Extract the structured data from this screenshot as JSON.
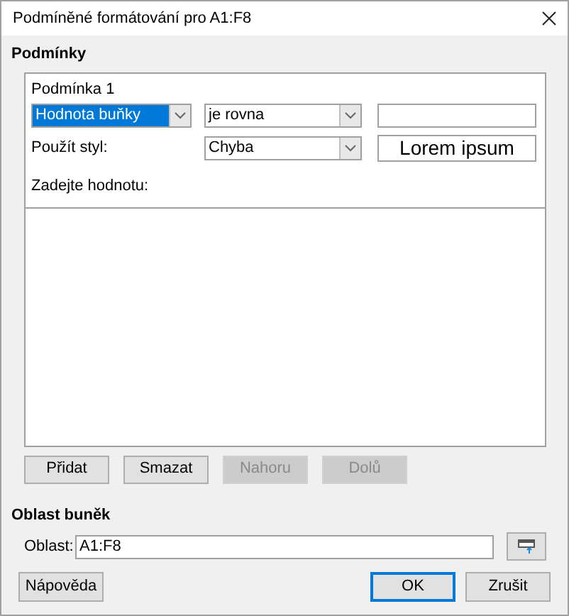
{
  "window": {
    "title": "Podmíněné formátování pro A1:F8"
  },
  "conditions": {
    "heading": "Podmínky",
    "items": [
      {
        "title": "Podmínka 1",
        "condition_type": {
          "value": "Hodnota buňky",
          "highlighted": true
        },
        "operator": {
          "value": "je rovna",
          "highlighted": false
        },
        "style_label": "Použít styl:",
        "style": {
          "value": "Chyba",
          "highlighted": false
        },
        "preview": "Lorem ipsum",
        "hint": "Zadejte hodnotu:"
      }
    ]
  },
  "list_buttons": [
    {
      "label": "Přidat",
      "disabled": false
    },
    {
      "label": "Smazat",
      "disabled": false
    },
    {
      "label": "Nahoru",
      "disabled": true
    },
    {
      "label": "Dolů",
      "disabled": true
    }
  ],
  "range": {
    "heading": "Oblast buněk",
    "label": "Oblast:",
    "value": "A1:F8"
  },
  "footer": [
    {
      "label": "Nápověda",
      "focused": false,
      "kind": "left"
    },
    {
      "label": "OK",
      "focused": true,
      "kind": "right"
    },
    {
      "label": "Zrušit",
      "focused": false,
      "kind": "right"
    }
  ]
}
